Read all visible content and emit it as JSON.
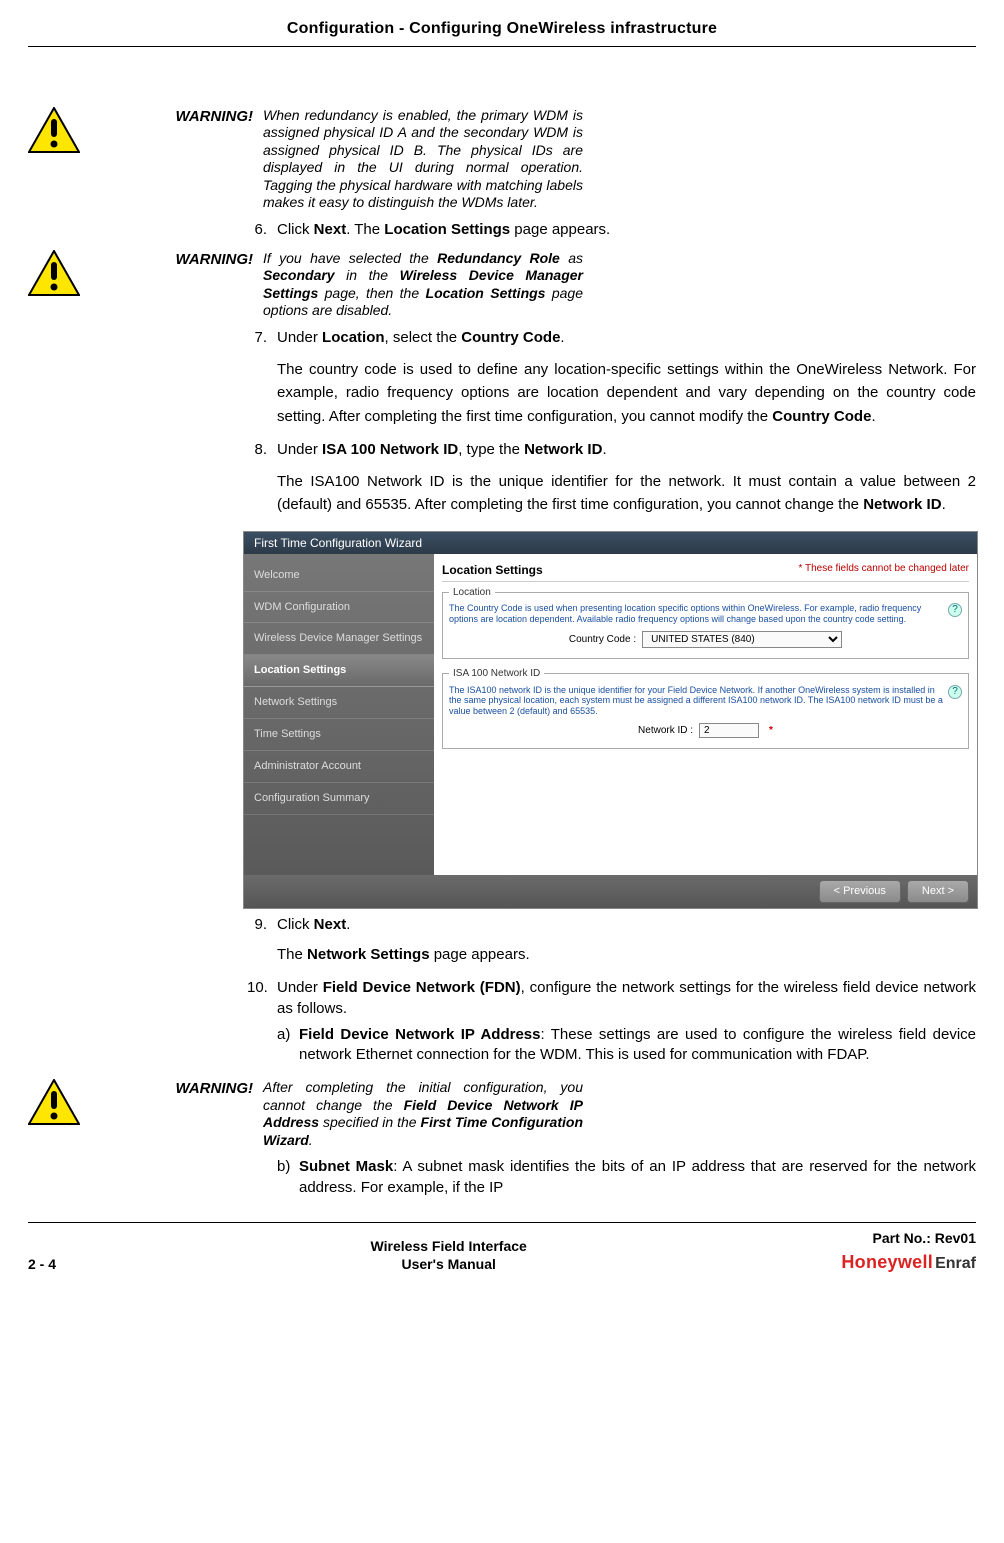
{
  "header": {
    "title": "Configuration - Configuring OneWireless infrastructure"
  },
  "warning_label": "WARNING!",
  "warn1": {
    "text_pre": "When redundancy is enabled, the primary WDM is assigned physical ID A and the secondary WDM is assigned physical ID B. The physical IDs are displayed in the UI during normal operation. Tagging the physical hardware with matching labels makes it easy to distinguish the WDMs later."
  },
  "step6": {
    "num": "6.",
    "p1": "Click ",
    "b1": "Next",
    "p2": ". The ",
    "b2": "Location Settings",
    "p3": " page appears."
  },
  "warn2": {
    "p1": "If you have selected the ",
    "b1": "Redundancy Role",
    "p2": " as ",
    "b2": "Secondary",
    "p3": " in the ",
    "b3": "Wireless Device Manager Settings",
    "p4": " page, then the ",
    "b4": "Location Settings",
    "p5": " page options are disabled."
  },
  "step7": {
    "num": "7.",
    "p1": "Under ",
    "b1": "Location",
    "p2": ", select the ",
    "b2": "Country Code",
    "p3": ".",
    "para_p1": "The country code is used to define any location-specific settings within the OneWireless Network. For example, radio frequency options are location dependent and vary depending on the country code setting. After completing the first time configuration, you cannot modify the ",
    "para_b1": "Country Code",
    "para_p2": "."
  },
  "step8": {
    "num": "8.",
    "p1": "Under ",
    "b1": "ISA 100 Network ID",
    "p2": ", type the ",
    "b2": "Network ID",
    "p3": ".",
    "para_p1": "The ISA100 Network ID is the unique identifier for the network. It must contain a value between 2 (default) and 65535. After completing the first time configu­ration, you cannot change the ",
    "para_b1": "Network ID",
    "para_p2": "."
  },
  "figure": {
    "window_title": "First Time Configuration Wizard",
    "side_items": [
      "Welcome",
      "WDM Configuration",
      "Wireless Device Manager Settings",
      "Location Settings",
      "Network Settings",
      "Time Settings",
      "Administrator Account",
      "Configuration Summary"
    ],
    "panel_title": "Location Settings",
    "req_note": "* These fields cannot be changed later",
    "loc_legend": "Location",
    "loc_blue": "The Country Code is used when presenting location specific options within OneWireless. For example, radio frequency options are location dependent. Available radio frequency options will change based upon the country code setting.",
    "cc_label": "Country Code :",
    "cc_value": "UNITED STATES (840)",
    "isa_legend": "ISA 100 Network ID",
    "isa_blue": "The ISA100 network ID is the unique identifier for your Field Device Network. If another OneWireless system is installed in the same physical location, each system must be assigned a different ISA100 network ID. The ISA100 network ID must be a value between 2 (default) and 65535.",
    "nid_label": "Network ID :",
    "nid_value": "2",
    "btn_prev": "< Previous",
    "btn_next": "Next >"
  },
  "step9": {
    "num": "9.",
    "p1": "Click ",
    "b1": "Next",
    "p2": ".",
    "para_p1": "The ",
    "para_b1": "Network Settings",
    "para_p2": " page appears."
  },
  "step10": {
    "num": "10.",
    "p1": "Under ",
    "b1": "Field Device Network (FDN)",
    "p2": ", configure the network settings for the wireless field device network as follows.",
    "a_label": "a)",
    "a_b1": "Field Device Network IP Address",
    "a_p1": ": These settings are used to configure the wireless field device network Ethernet connection for the WDM. This is used for communication with FDAP."
  },
  "warn3": {
    "p1": "After completing the initial configuration, you cannot change the ",
    "b1": "Field Device Network IP Address",
    "p2": " specified in the ",
    "b2": "First Time Configuration Wizard",
    "p3": "."
  },
  "step10b": {
    "b_label": "b)",
    "b1": "Subnet Mask",
    "p1": ": A subnet mask identifies the bits of an IP address that are reserved for the network address. For example, if the IP"
  },
  "footer": {
    "page_num": "2 - 4",
    "doc_title_l1": "Wireless Field Interface",
    "doc_title_l2": "User's Manual",
    "part_no": "Part No.: Rev01",
    "brand1": "Honeywell",
    "brand2": "Enraf"
  }
}
